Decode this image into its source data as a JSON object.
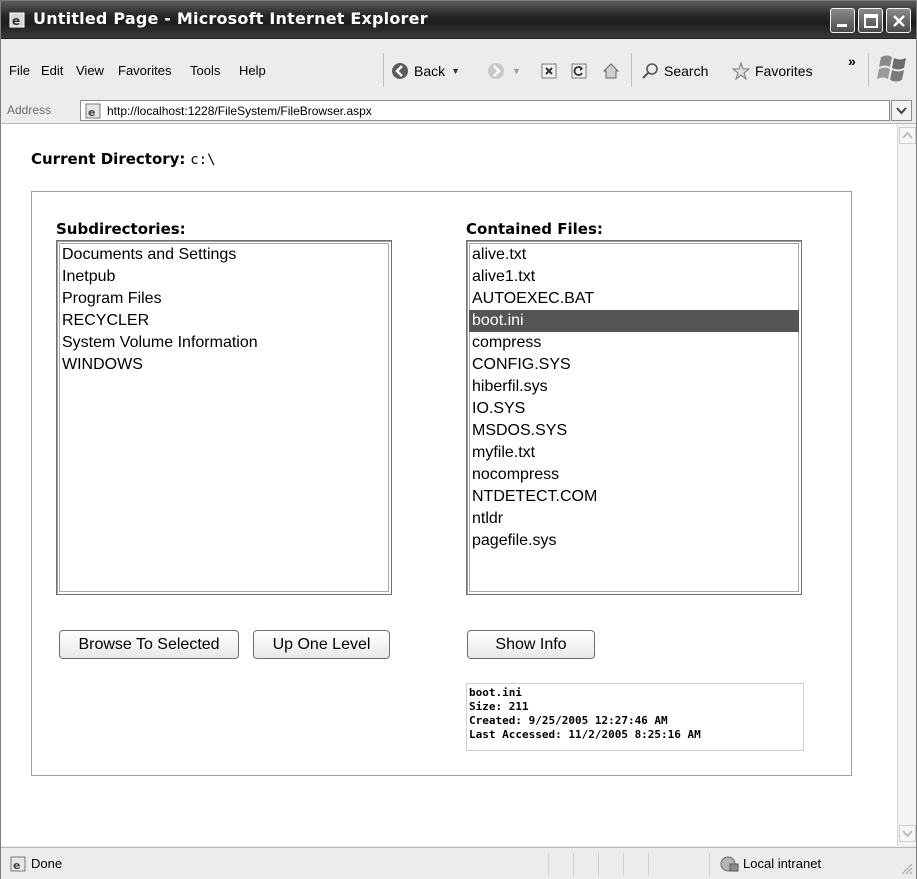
{
  "window": {
    "title": "Untitled Page - Microsoft Internet Explorer"
  },
  "menu": {
    "items": [
      "File",
      "Edit",
      "View",
      "Favorites",
      "Tools",
      "Help"
    ]
  },
  "toolbar": {
    "back_label": "Back",
    "search_label": "Search",
    "favorites_label": "Favorites",
    "more_label": "»"
  },
  "address": {
    "label": "Address",
    "url": "http://localhost:1228/FileSystem/FileBrowser.aspx"
  },
  "page": {
    "current_directory_label": "Current Directory:",
    "current_directory_value": "c:\\",
    "subdirectories_title": "Subdirectories:",
    "subdirectories": [
      "Documents and Settings",
      "Inetpub",
      "Program Files",
      "RECYCLER",
      "System Volume Information",
      "WINDOWS"
    ],
    "files_title": "Contained Files:",
    "files": [
      "alive.txt",
      "alive1.txt",
      "AUTOEXEC.BAT",
      "boot.ini",
      "compress",
      "CONFIG.SYS",
      "hiberfil.sys",
      "IO.SYS",
      "MSDOS.SYS",
      "myfile.txt",
      "nocompress",
      "NTDETECT.COM",
      "ntldr",
      "pagefile.sys"
    ],
    "selected_file": "boot.ini",
    "browse_button": "Browse To Selected",
    "up_button": "Up One Level",
    "info_button": "Show Info",
    "info": {
      "name": "boot.ini",
      "size": "Size: 211",
      "created": "Created: 9/25/2005 12:27:46 AM",
      "accessed": "Last Accessed: 11/2/2005 8:25:16 AM"
    }
  },
  "status": {
    "text": "Done",
    "zone": "Local intranet"
  },
  "colors": {
    "selection": "#555555",
    "titlebar": "#262626"
  }
}
